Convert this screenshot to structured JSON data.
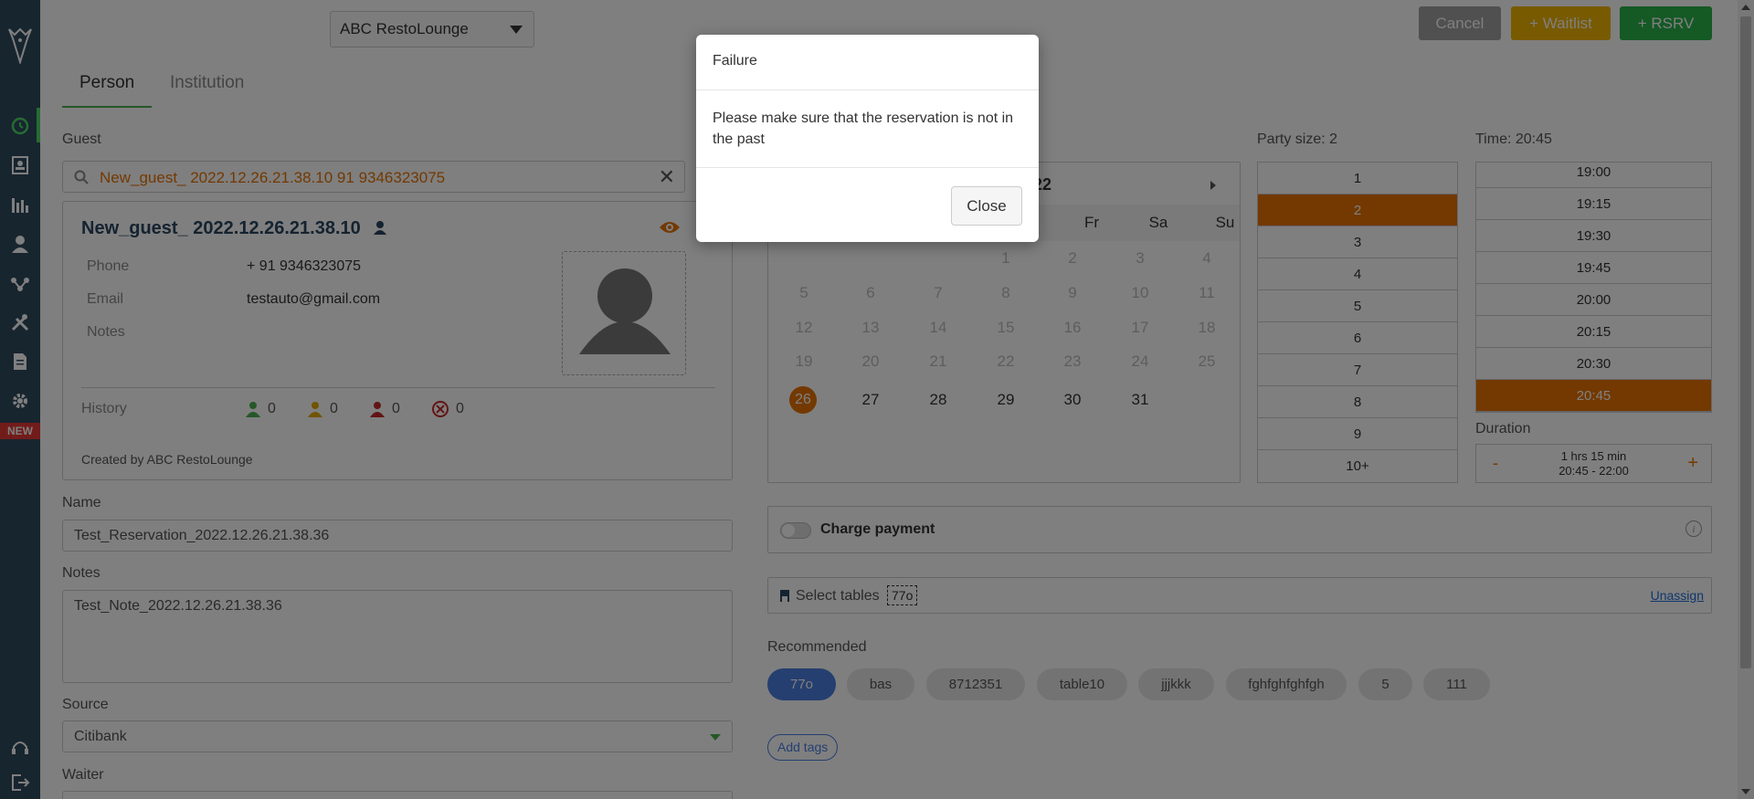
{
  "topbar": {
    "venue": "ABC RestoLounge",
    "cancel_label": "Cancel",
    "waitlist_label": "+ Waitlist",
    "rsrv_label": "+ RSRV"
  },
  "sidebar": {
    "new_badge": "NEW",
    "icons": [
      "reservations-icon",
      "contacts-icon",
      "reports-icon",
      "guests-icon",
      "integrations-icon",
      "tools-icon",
      "documents-icon",
      "settings-icon"
    ],
    "bottom_icons": [
      "support-headset-icon",
      "logout-icon"
    ]
  },
  "tabs": [
    {
      "label": "Person",
      "active": true
    },
    {
      "label": "Institution",
      "active": false
    }
  ],
  "guest": {
    "section_label": "Guest",
    "search_value": "New_guest_ 2022.12.26.21.38.10 91 9346323075",
    "name": "New_guest_ 2022.12.26.21.38.10",
    "phone_label": "Phone",
    "phone": "+ 91 9346323075",
    "email_label": "Email",
    "email": "testauto@gmail.com",
    "notes_label": "Notes",
    "history_label": "History",
    "history": [
      "0",
      "0",
      "0",
      "0"
    ],
    "created_by": "Created by ABC RestoLounge"
  },
  "form": {
    "name_label": "Name",
    "name_value": "Test_Reservation_2022.12.26.21.38.36",
    "notes_label": "Notes",
    "notes_value": "Test_Note_2022.12.26.21.38.36",
    "source_label": "Source",
    "source_value": "Citibank",
    "waiter_label": "Waiter"
  },
  "calendar": {
    "month_partial": "022",
    "dow": [
      "Fr",
      "Sa",
      "Su"
    ],
    "past_rows": [
      [
        "",
        "",
        "",
        "1",
        "2",
        "3",
        "4"
      ],
      [
        "5",
        "6",
        "7",
        "8",
        "9",
        "10",
        "11"
      ],
      [
        "12",
        "13",
        "14",
        "15",
        "16",
        "17",
        "18"
      ],
      [
        "19",
        "20",
        "21",
        "22",
        "23",
        "24",
        "25"
      ]
    ],
    "selected_day": "26",
    "current_row": [
      "27",
      "28",
      "29",
      "30",
      "31"
    ]
  },
  "party": {
    "label": "Party size: 2",
    "options": [
      "1",
      "2",
      "3",
      "4",
      "5",
      "6",
      "7",
      "8",
      "9",
      "10+"
    ],
    "selected": "2"
  },
  "time": {
    "label": "Time: 20:45",
    "options": [
      "19:00",
      "19:15",
      "19:30",
      "19:45",
      "20:00",
      "20:15",
      "20:30",
      "20:45"
    ],
    "selected": "20:45"
  },
  "duration": {
    "label": "Duration",
    "minus": "-",
    "plus": "+",
    "line1": "1 hrs 15 min",
    "line2": "20:45 - 22:00"
  },
  "charge": {
    "label": "Charge payment",
    "enabled": false
  },
  "tables": {
    "placeholder": "Select tables",
    "selected_chip": "77o",
    "unassign_label": "Unassign"
  },
  "recommended": {
    "label": "Recommended",
    "chips": [
      "77o",
      "bas",
      "8712351",
      "table10",
      "jjjkkk",
      "fghfghfghfgh",
      "5",
      "111"
    ],
    "selected": "77o"
  },
  "add_tags_label": "Add tags",
  "modal": {
    "title": "Failure",
    "message": "Please make sure that the reservation is not in the past",
    "close_label": "Close"
  },
  "colors": {
    "accent": "#e67300",
    "sidebar": "#2f4a5f",
    "primary_blue": "#4a7fe0",
    "success": "#2bb34b",
    "warning": "#f0b400"
  }
}
